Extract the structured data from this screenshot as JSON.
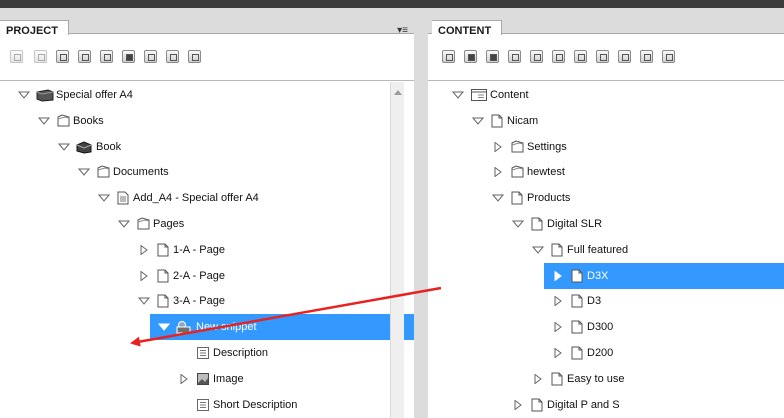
{
  "project_panel": {
    "tab_label": "PROJECT",
    "menu_icon": "panel-menu-icon",
    "toolbar_icons": [
      "view-icon",
      "save-icon",
      "edit-icon",
      "add-icon",
      "duplicate-icon",
      "delete-icon",
      "new-page-icon",
      "properties-icon",
      "refresh-icon"
    ],
    "tree": [
      {
        "label": "Special offer A4",
        "icon": "publication-icon",
        "expanded": true,
        "level": 0
      },
      {
        "label": "Books",
        "icon": "folder-icon",
        "expanded": true,
        "level": 1
      },
      {
        "label": "Book",
        "icon": "book-icon",
        "expanded": true,
        "level": 2
      },
      {
        "label": "Documents",
        "icon": "folder-icon",
        "expanded": true,
        "level": 3
      },
      {
        "label": "Add_A4 - Special offer A4",
        "icon": "document-icon",
        "expanded": true,
        "level": 4
      },
      {
        "label": "Pages",
        "icon": "folder-icon",
        "expanded": true,
        "level": 5
      },
      {
        "label": "1-A - Page",
        "icon": "page-icon",
        "expanded": false,
        "level": 6
      },
      {
        "label": "2-A - Page",
        "icon": "page-icon",
        "expanded": false,
        "level": 6
      },
      {
        "label": "3-A - Page",
        "icon": "page-icon",
        "expanded": true,
        "level": 6
      },
      {
        "label": "New snippet",
        "icon": "snippet-icon",
        "expanded": true,
        "level": 7,
        "selected": true
      },
      {
        "label": "Description",
        "icon": "text-field-icon",
        "level": 8
      },
      {
        "label": "Image",
        "icon": "image-field-icon",
        "expanded": false,
        "level": 8
      },
      {
        "label": "Short Description",
        "icon": "text-field-icon",
        "level": 8
      }
    ]
  },
  "content_panel": {
    "tab_label": "CONTENT",
    "toolbar_icons": [
      "add-icon",
      "delete-icon",
      "move-icon",
      "copy-icon",
      "paste-icon",
      "expand-icon",
      "up-icon",
      "down-icon",
      "collapse-icon",
      "properties-icon",
      "refresh-icon"
    ],
    "tree": [
      {
        "label": "Content",
        "icon": "content-root-icon",
        "expanded": true,
        "level": 0
      },
      {
        "label": "Nicam",
        "icon": "page-icon",
        "expanded": true,
        "level": 1
      },
      {
        "label": "Settings",
        "icon": "folder-icon",
        "expanded": false,
        "level": 2
      },
      {
        "label": "hewtest",
        "icon": "folder-icon",
        "expanded": false,
        "level": 2
      },
      {
        "label": "Products",
        "icon": "page-icon",
        "expanded": true,
        "level": 2
      },
      {
        "label": "Digital SLR",
        "icon": "page-icon",
        "expanded": true,
        "level": 3
      },
      {
        "label": "Full featured",
        "icon": "page-icon",
        "expanded": true,
        "level": 4
      },
      {
        "label": "D3X",
        "icon": "page-icon",
        "expanded": false,
        "level": 5,
        "selected": true
      },
      {
        "label": "D3",
        "icon": "page-icon",
        "expanded": false,
        "level": 5
      },
      {
        "label": "D300",
        "icon": "page-icon",
        "expanded": false,
        "level": 5
      },
      {
        "label": "D200",
        "icon": "page-icon",
        "expanded": false,
        "level": 5
      },
      {
        "label": "Easy to use",
        "icon": "page-icon",
        "expanded": false,
        "level": 4
      },
      {
        "label": "Digital P and S",
        "icon": "page-icon",
        "expanded": false,
        "level": 3
      }
    ]
  },
  "colors": {
    "selection": "#3399ff",
    "annotation_arrow": "#e8231f",
    "panel_header": "#3c3c3c"
  }
}
